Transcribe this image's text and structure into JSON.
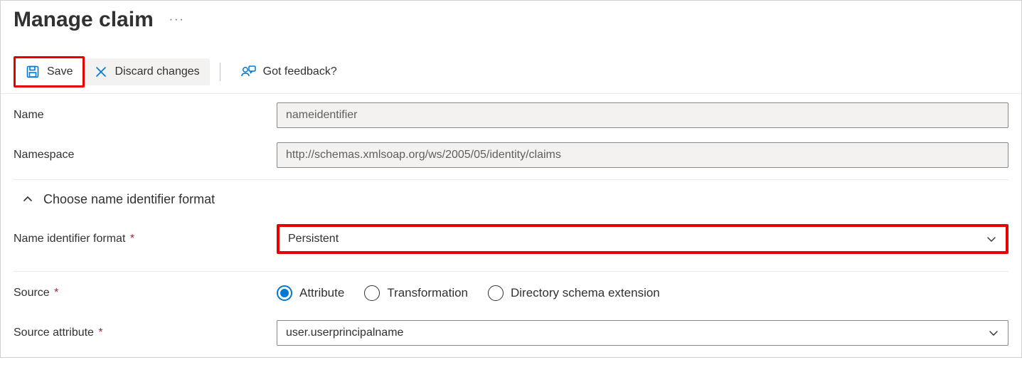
{
  "header": {
    "title": "Manage claim",
    "more_label": "···"
  },
  "toolbar": {
    "save_label": "Save",
    "discard_label": "Discard changes",
    "feedback_label": "Got feedback?"
  },
  "colors": {
    "accent": "#0078d4",
    "highlight": "#e60000",
    "required": "#a4262c"
  },
  "form": {
    "name": {
      "label": "Name",
      "value": "nameidentifier"
    },
    "namespace": {
      "label": "Namespace",
      "value": "http://schemas.xmlsoap.org/ws/2005/05/identity/claims"
    },
    "collapser": {
      "label": "Choose name identifier format",
      "expanded": true
    },
    "name_identifier_format": {
      "label": "Name identifier format",
      "required": "*",
      "value": "Persistent"
    },
    "source": {
      "label": "Source",
      "required": "*",
      "options": [
        {
          "label": "Attribute",
          "selected": true
        },
        {
          "label": "Transformation",
          "selected": false
        },
        {
          "label": "Directory schema extension",
          "selected": false
        }
      ]
    },
    "source_attribute": {
      "label": "Source attribute",
      "required": "*",
      "value": "user.userprincipalname"
    }
  }
}
